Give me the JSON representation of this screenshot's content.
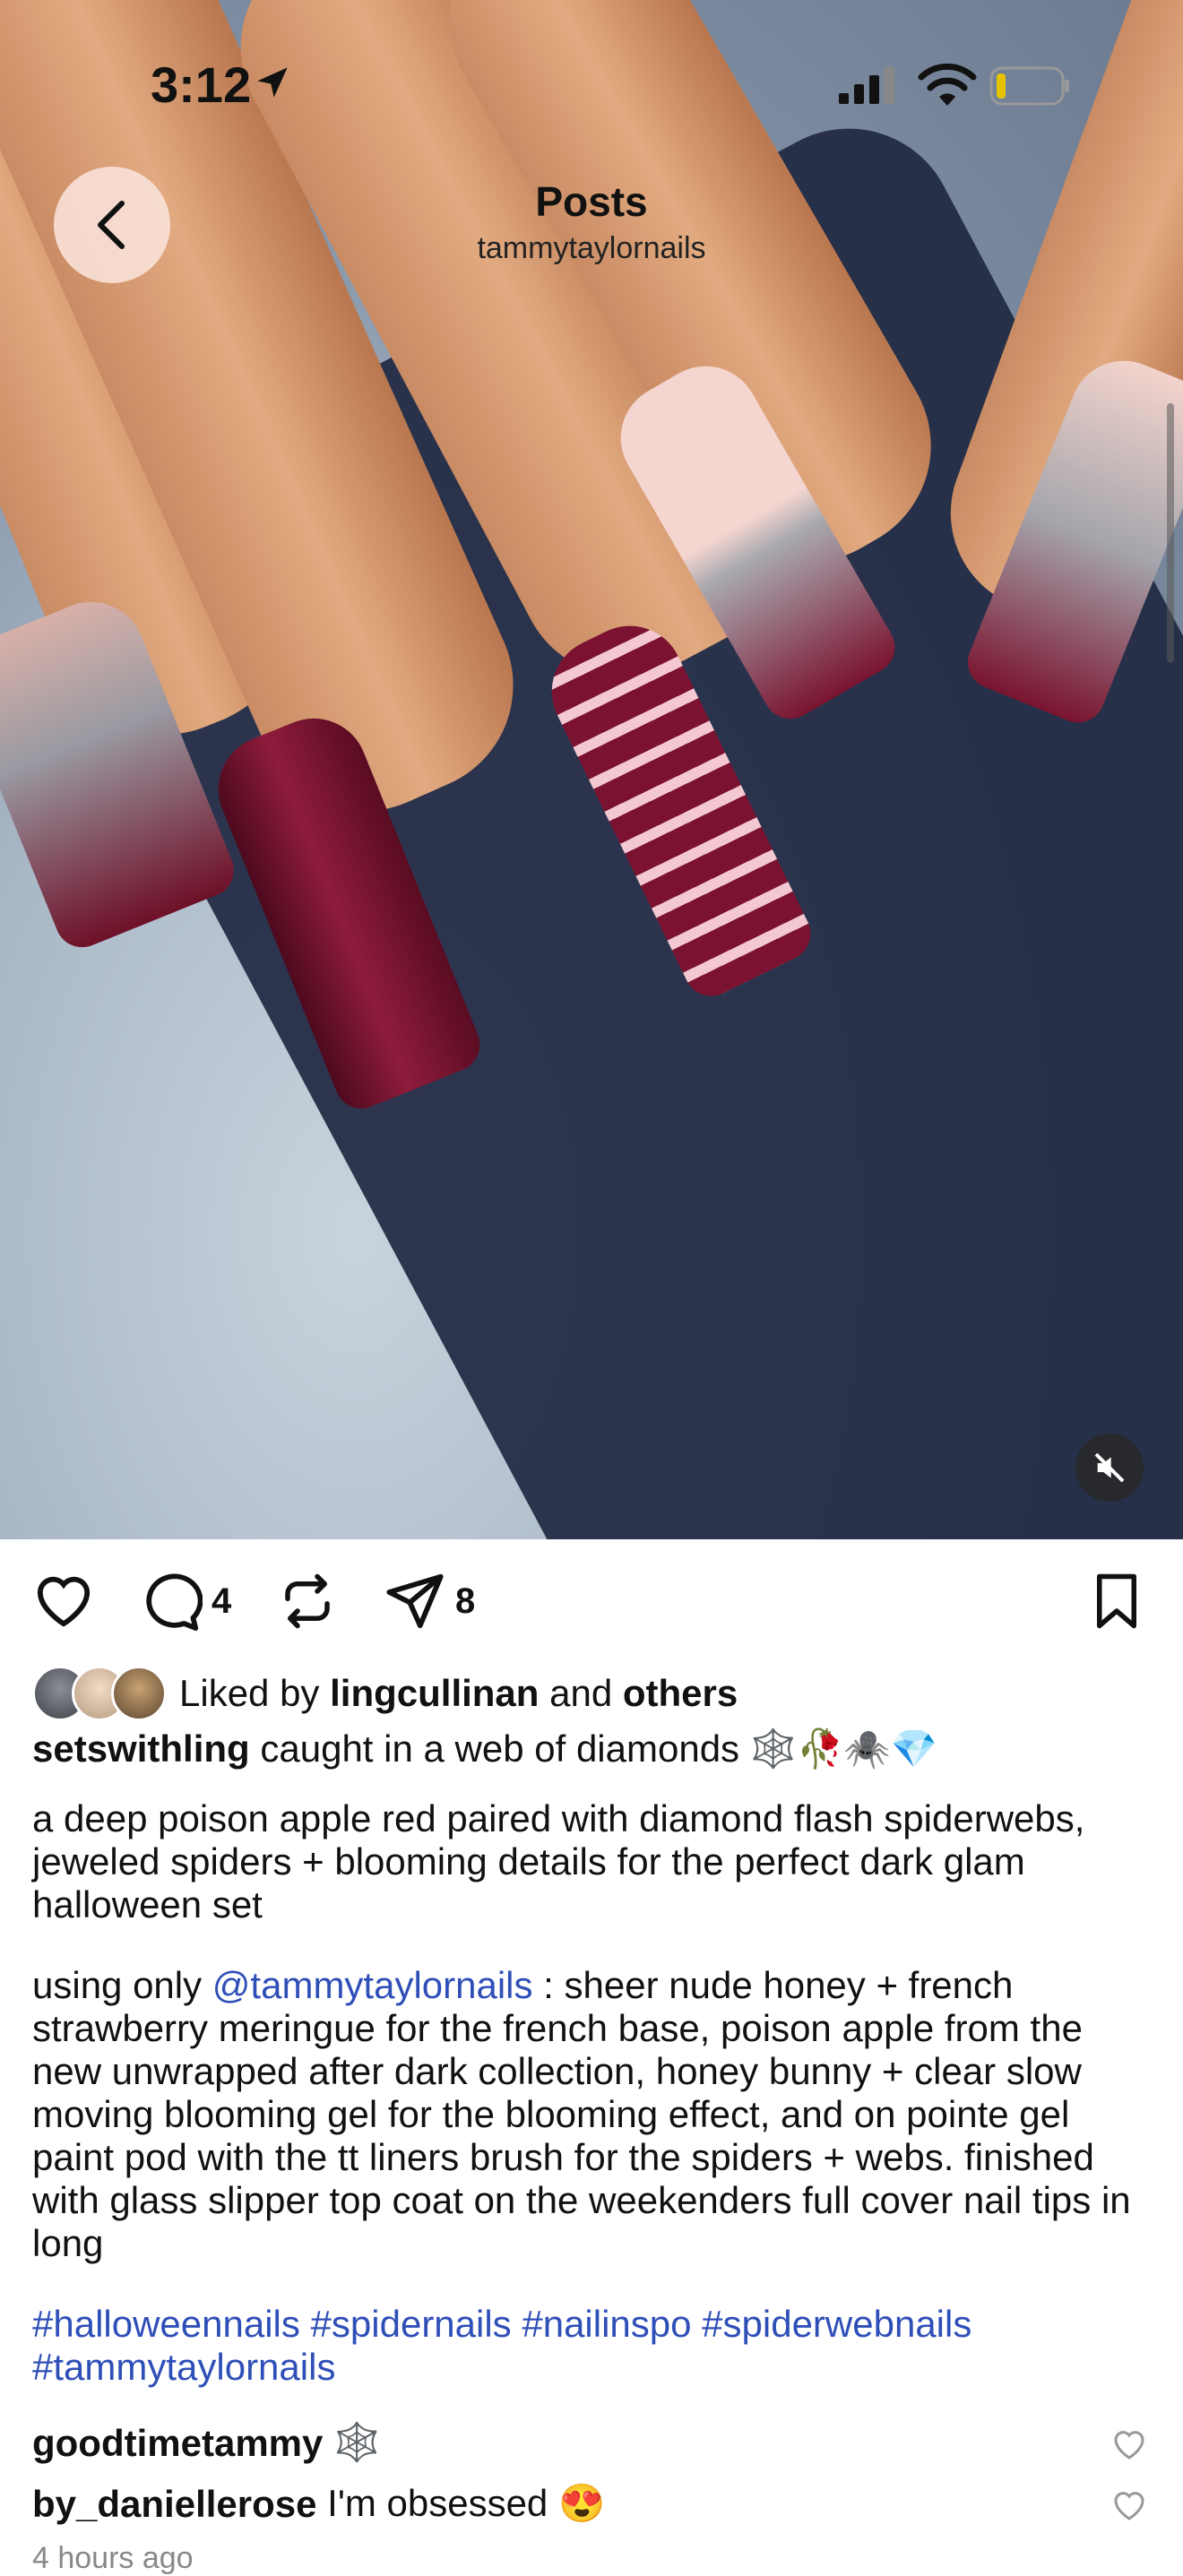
{
  "status_bar": {
    "time": "3:12"
  },
  "nav": {
    "title": "Posts",
    "subtitle": "tammytaylornails"
  },
  "actions": {
    "comments_count": "4",
    "shares_count": "8"
  },
  "liked": {
    "prefix": "Liked by ",
    "user": "lingcullinan",
    "and": " and ",
    "others": "others"
  },
  "caption": {
    "username": "setswithling",
    "first_line": " caught in a web of diamonds 🕸️🥀🕷️💎",
    "para1": "a deep poison apple red paired with diamond flash spiderwebs, jeweled spiders + blooming details for the perfect dark glam halloween set",
    "para2_prefix": "using only ",
    "para2_mention": "@tammytaylornails",
    "para2_rest": " : sheer nude honey + french strawberry meringue for the french base, poison apple from the new unwrapped after dark collection, honey bunny + clear slow moving blooming gel for the blooming effect, and on pointe gel paint pod with the tt liners brush for the spiders + webs. finished with glass slipper top coat on the weekenders full cover nail tips in long",
    "hashtags": "#halloweennails #spidernails #nailinspo #spiderwebnails #tammytaylornails"
  },
  "comments": [
    {
      "user": "goodtimetammy",
      "text": " 🕸️"
    },
    {
      "user": "by_daniellerose",
      "text": " I'm obsessed 😍"
    }
  ],
  "timestamp": "4 hours ago",
  "colors": {
    "link": "#2f4fb8",
    "nail_red": "#7a1430"
  }
}
